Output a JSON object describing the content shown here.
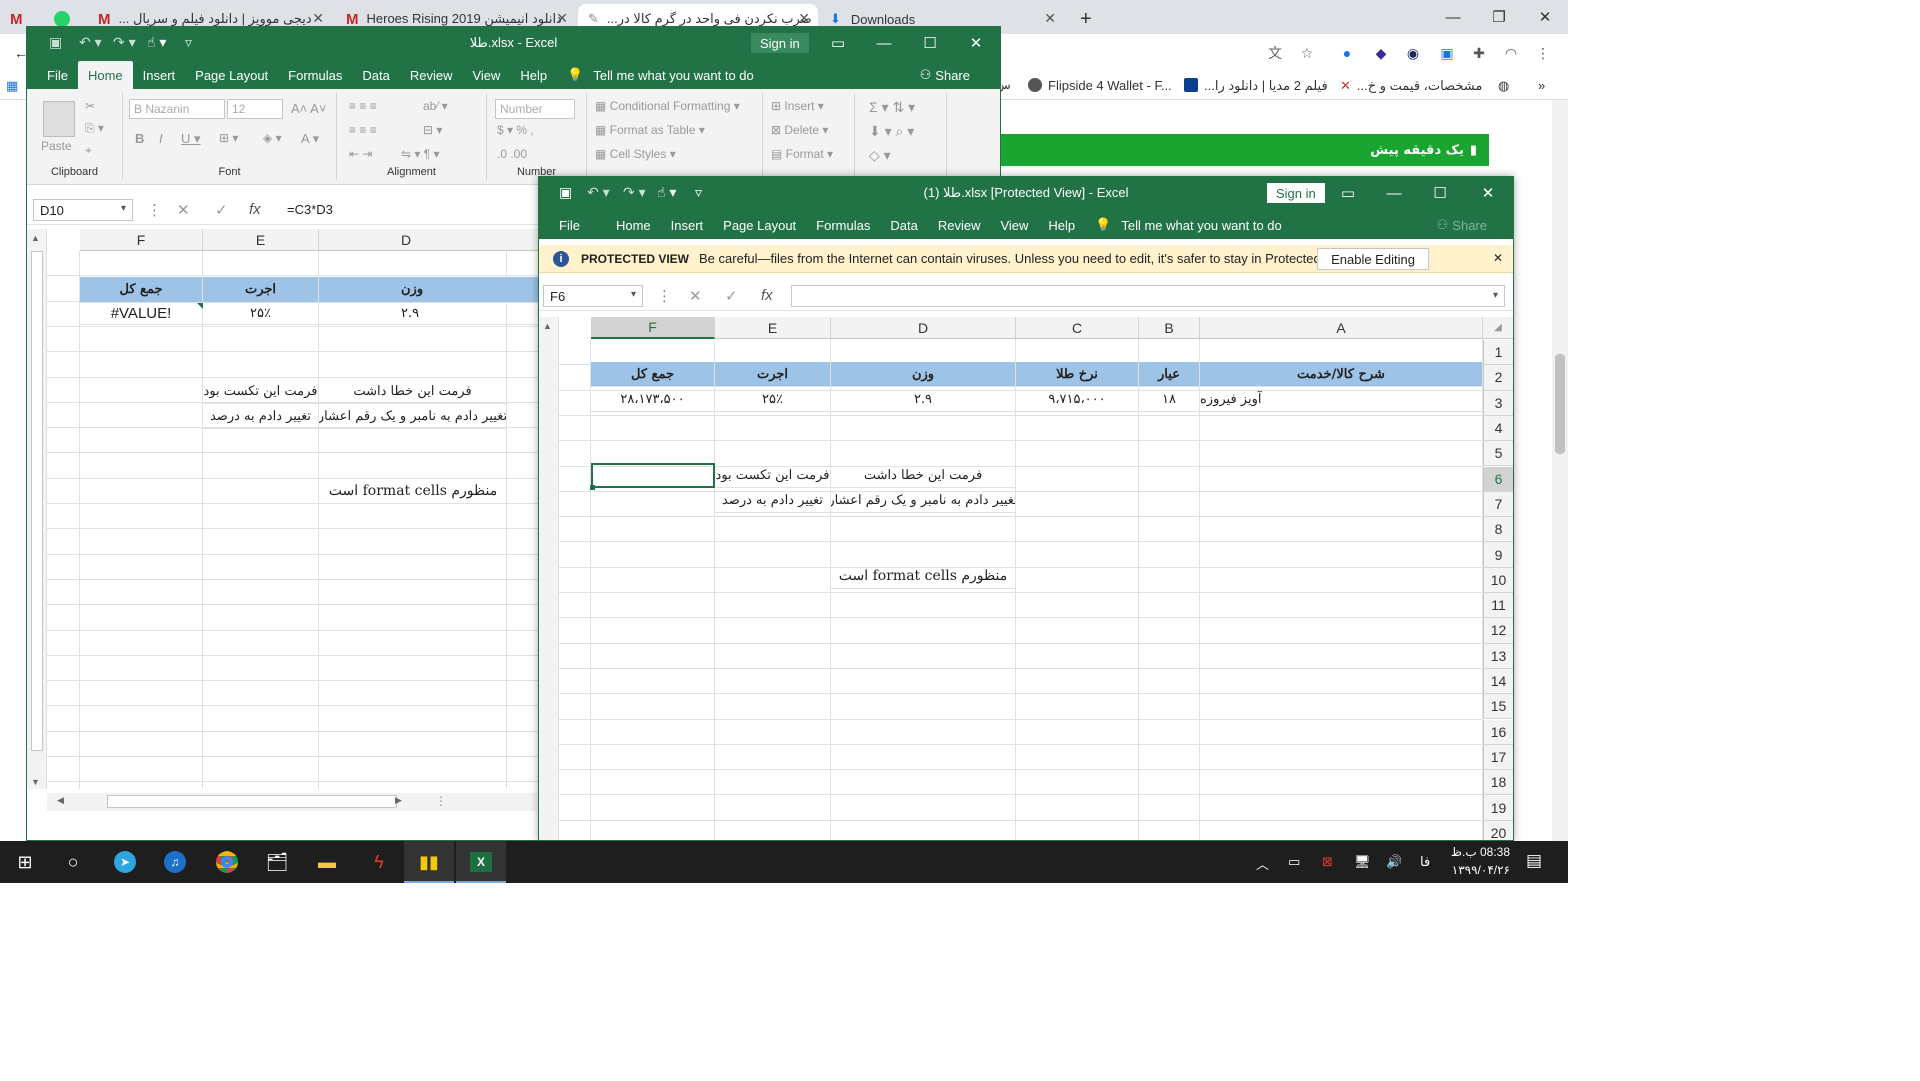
{
  "chrome": {
    "tabs": [
      {
        "label": "دیجی موویز | دانلود فیلم و سریال ...",
        "active": false
      },
      {
        "label": "دانلود انیمیشن 2019 Heroes Rising",
        "active": false
      },
      {
        "label": "ضرب نکردن فی واحد در گرم کالا در...",
        "active": true
      },
      {
        "label": "Downloads",
        "active": false
      }
    ],
    "bookmarks": [
      {
        "label": "Flipside 4 Wallet - F..."
      },
      {
        "label": "فیلم 2 مدیا | دانلود را..."
      },
      {
        "label": "مشخصات، قیمت و خ..."
      },
      {
        "label": "س"
      }
    ],
    "banner": "یک دقیقه پیش"
  },
  "back_window": {
    "title": "طلا.xlsx  -  Excel",
    "sign_in": "Sign in",
    "share": "Share",
    "menu": [
      "File",
      "Home",
      "Insert",
      "Page Layout",
      "Formulas",
      "Data",
      "Review",
      "View",
      "Help"
    ],
    "active_menu": "Home",
    "tell_me": "Tell me what you want to do",
    "ribbon": {
      "paste": "Paste",
      "font_name": "B Nazanin",
      "font_size": "12",
      "number_format": "Number",
      "conditional": "Conditional Formatting",
      "format_table": "Format as Table",
      "cell_styles": "Cell Styles",
      "insert": "Insert",
      "delete": "Delete",
      "format": "Format",
      "groups": {
        "clipboard": "Clipboard",
        "font": "Font",
        "alignment": "Alignment",
        "number": "Number"
      }
    },
    "name_box": "D10",
    "formula": "=C3*D3",
    "columns": [
      "F",
      "E",
      "D"
    ],
    "rows": {
      "r2": {
        "F": "جمع کل",
        "E": "اجرت",
        "D": "وزن"
      },
      "r3": {
        "F": "#VALUE!",
        "E": "۲۵٪",
        "D": "۲.۹"
      },
      "r6": {
        "E": "فرمت این تکست بود",
        "D": "فرمت این خطا داشت"
      },
      "r7": {
        "E": "تغییر دادم به درصد",
        "D": "تغییر دادم به نامبر و یک رقم اعشار"
      },
      "r10": {
        "D": "منظورم format cells است"
      }
    }
  },
  "front_window": {
    "title": "طلا (1).xlsx  [Protected View]  -  Excel",
    "sign_in": "Sign in",
    "share": "Share",
    "menu": [
      "File",
      "Home",
      "Insert",
      "Page Layout",
      "Formulas",
      "Data",
      "Review",
      "View",
      "Help"
    ],
    "tell_me": "Tell me what you want to do",
    "protected": {
      "label": "PROTECTED VIEW",
      "message": "Be careful—files from the Internet can contain viruses. Unless you need to edit, it's safer to stay in Protected View.",
      "button": "Enable Editing"
    },
    "name_box": "F6",
    "formula": "",
    "columns": [
      "F",
      "E",
      "D",
      "C",
      "B",
      "A"
    ],
    "row_numbers": [
      "1",
      "2",
      "3",
      "4",
      "5",
      "6",
      "7",
      "8",
      "9",
      "10",
      "11",
      "12",
      "13",
      "14",
      "15",
      "16",
      "17",
      "18",
      "19",
      "20"
    ],
    "rows": {
      "r2": {
        "F": "جمع کل",
        "E": "اجرت",
        "D": "وزن",
        "C": "نرخ طلا",
        "B": "عیار",
        "A": "شرح کالا/خدمت"
      },
      "r3": {
        "F": "۲۸،۱۷۳،۵۰۰",
        "E": "۲۵٪",
        "D": "۲.۹",
        "C": "۹،۷۱۵،۰۰۰",
        "B": "۱۸",
        "A": "آویز فیروزه"
      },
      "r6": {
        "E": "فرمت این تکست بود",
        "D": "فرمت این خطا داشت"
      },
      "r7": {
        "E": "تغییر دادم به درصد",
        "D": "تغییر دادم به نامبر و یک رقم اعشار"
      },
      "r10": {
        "D": "منظورم format cells است"
      }
    }
  },
  "taskbar": {
    "time": "08:38 ب.ظ",
    "date": "۱۳۹۹/۰۴/۲۶",
    "lang": "فا"
  },
  "colors": {
    "excel_green": "#217346",
    "header_blue": "#9dc3e6",
    "banner_green": "#1aa531"
  }
}
